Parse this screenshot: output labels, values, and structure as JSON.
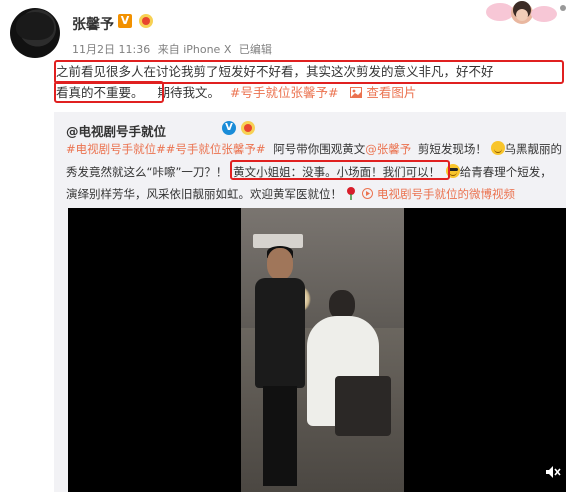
{
  "post": {
    "author_name": "张馨予",
    "v_badge": "V",
    "meta": {
      "date": "11月2日 11:36",
      "source": "来自 iPhone X",
      "edited": "已编辑"
    },
    "text_line1": "之前看见很多人在讨论我剪了短发好不好看，其实这次剪发的意义非凡，好不好",
    "text_line2_part1": "看真的不重要。",
    "text_line2_part2": "期待我文。",
    "topic_link": "#号手就位张馨予#",
    "view_pic": "查看图片"
  },
  "repost": {
    "author": "@电视剧号手就位",
    "v_badge": "V",
    "line1_topics": "#电视剧号手就位##号手就位张馨予#",
    "line1_text": "阿号带你围观黄文",
    "line1_mention": "@张馨予",
    "line1_text2": "剪短发现场！",
    "line1_text3": "乌黑靓丽的",
    "line2_text": "秀发竟然就这么“咔嚓”一刀？！",
    "line2_quote": "黄文小姐姐：没事。小场面！我们可以！",
    "line2_text2": "给青春理个短发，",
    "line3_text": "演绎别样芳华，风采依旧靓丽如虹。欢迎黄军医就位！",
    "line3_link": "电视剧号手就位的微博视频"
  },
  "icons": {
    "mute": "mute-icon",
    "emoji_smile": "smile-emoji",
    "emoji_cool": "cool-emoji",
    "rose": "rose-icon",
    "video_link": "video-link-icon",
    "picture": "picture-icon"
  },
  "colors": {
    "link": "#eb7350",
    "highlight_box": "#e02020",
    "repost_bg": "#f2f2f5",
    "v_badge": "#f29100",
    "blue_v": "#1a8cd8"
  }
}
